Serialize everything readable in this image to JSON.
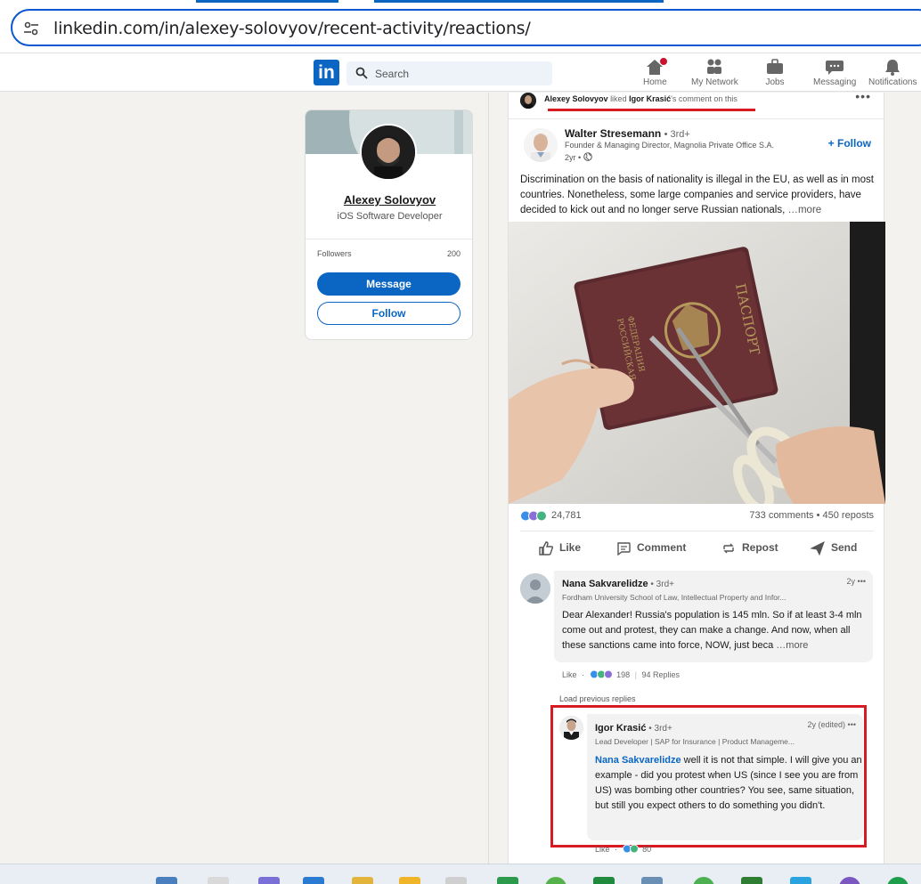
{
  "browser": {
    "url": "linkedin.com/in/alexey-solovyov/recent-activity/reactions/"
  },
  "nav": {
    "logo_text": "in",
    "search_placeholder": "Search",
    "items": [
      {
        "label": "Home"
      },
      {
        "label": "My Network"
      },
      {
        "label": "Jobs"
      },
      {
        "label": "Messaging"
      },
      {
        "label": "Notifications"
      }
    ]
  },
  "profile": {
    "name": "Alexey Solovyov",
    "title": "iOS Software Developer",
    "followers_label": "Followers",
    "followers_count": "200",
    "message_label": "Message",
    "follow_label": "Follow"
  },
  "activity": {
    "actor": "Alexey Solovyov",
    "verb": "liked",
    "target": "Igor Krasić",
    "suffix": "'s comment on this",
    "more": "•••"
  },
  "post": {
    "author": "Walter Stresemann",
    "degree": "• 3rd+",
    "headline": "Founder & Managing Director, Magnolia Private Office S.A.",
    "time": "2yr •",
    "follow_label": "+ Follow",
    "text": "Discrimination on the basis of nationality is illegal in the EU, as well as in most countries. Nonetheless, some large companies and service providers, have decided to kick out and no longer serve Russian nationals, ",
    "more": " …more",
    "reactions_count": "24,781",
    "comments_reposts": "733 comments • 450 reposts",
    "actions": [
      "Like",
      "Comment",
      "Repost",
      "Send"
    ]
  },
  "comment1": {
    "name": "Nana Sakvarelidze",
    "degree": " • 3rd+",
    "headline": "Fordham University School of Law, Intellectual Property and Infor...",
    "time": "2y •••",
    "text": "Dear Alexander! Russia's population is 145 mln. So if at least 3-4 mln come out and protest, they can make a change. And now, when all these sanctions came into force, NOW, just beca",
    "more": "  …more",
    "like": "Like",
    "reaction_count": "198",
    "replies": "94 Replies",
    "load_previous": "Load previous replies"
  },
  "reply": {
    "name": "Igor Krasić",
    "degree": " • 3rd+",
    "headline": "Lead Developer | SAP for Insurance | Product Manageme...",
    "time": "2y (edited) •••",
    "mention": "Nana Sakvarelidze",
    "text": " well it is not that simple. I will give you an example - did you protest when US (since I see you are from US) was bombing other countries? You see, same situation, but still you expect others to do something you didn't.",
    "like": "Like",
    "reaction_count": "80"
  },
  "colors": {
    "linkedin_blue": "#0a66c2",
    "highlight_red": "#d81b23",
    "page_bg": "#f3f2ef"
  }
}
